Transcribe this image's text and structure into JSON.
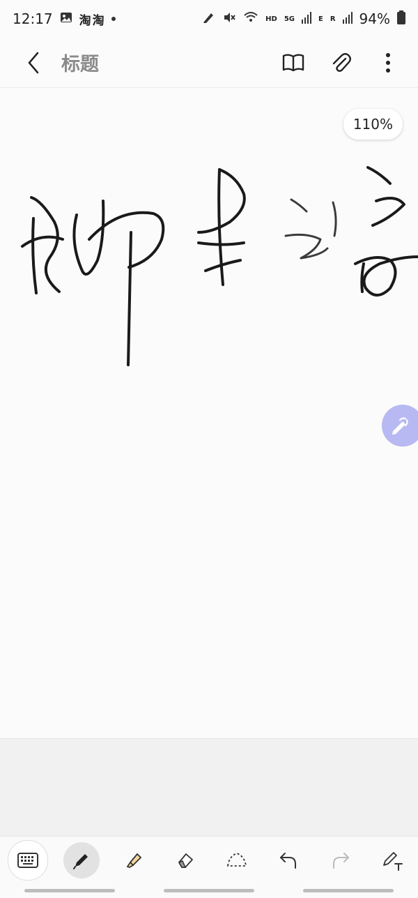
{
  "status_bar": {
    "time": "12:17",
    "app1": "淘",
    "app2": "淘",
    "network": "HD",
    "network2": "5G",
    "network3": "E",
    "network4": "R",
    "battery": "94%"
  },
  "app_bar": {
    "title": "标题"
  },
  "zoom": {
    "level": "110%"
  },
  "toolbar": {
    "tools": [
      "keyboard",
      "pen",
      "highlighter",
      "eraser",
      "lasso",
      "undo",
      "redo",
      "pen-to-text"
    ],
    "active_tool": "pen"
  },
  "colors": {
    "accent": "#b8b8f2",
    "ink": "#1a1a1a"
  }
}
